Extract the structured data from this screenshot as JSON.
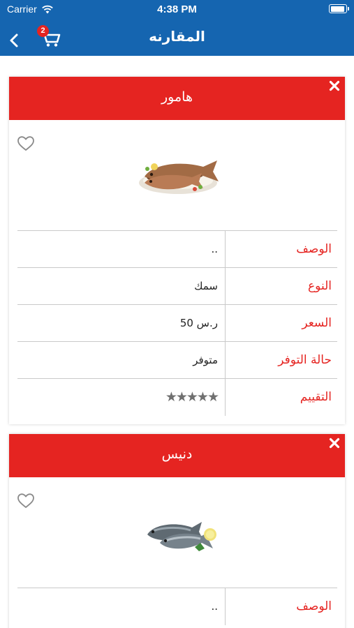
{
  "status_bar": {
    "carrier": "Carrier",
    "time": "4:38 PM"
  },
  "header": {
    "title": "المقارنه",
    "cart_count": "2",
    "color": "#1565b0"
  },
  "accent_color": "#e52421",
  "products": [
    {
      "name": "هامور",
      "image_icon": "grouper-fish-plate",
      "specs": [
        {
          "label": "الوصف",
          "value": ".."
        },
        {
          "label": "النوع",
          "value": "سمك"
        },
        {
          "label": "السعر",
          "value": "ر.س 50"
        },
        {
          "label": "حالة التوفر",
          "value": "متوفر"
        },
        {
          "label": "التقييم",
          "value": "★★★★★"
        }
      ]
    },
    {
      "name": "دنيس",
      "image_icon": "sea-bream-fish",
      "specs": [
        {
          "label": "الوصف",
          "value": ".."
        }
      ]
    }
  ]
}
